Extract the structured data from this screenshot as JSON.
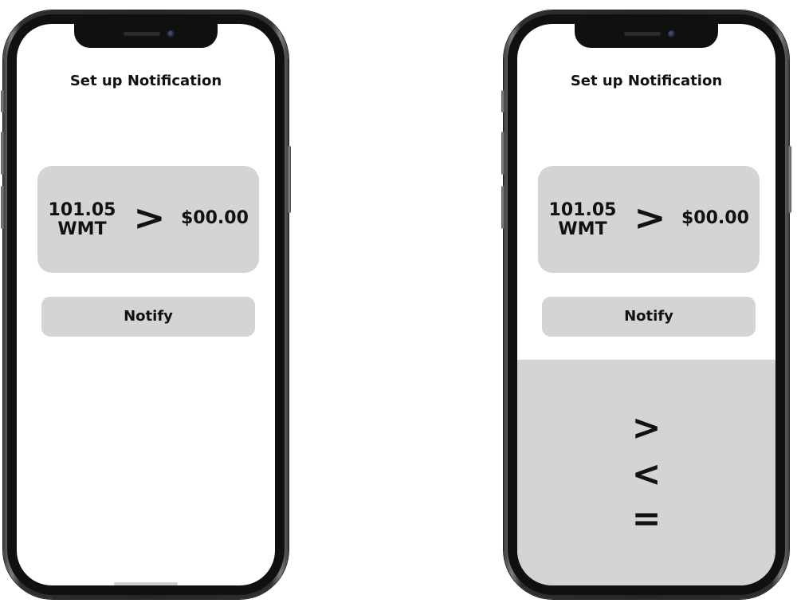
{
  "screens": [
    {
      "title": "Set up Notification",
      "stock_price": "101.05",
      "stock_symbol": "WMT",
      "comparator": ">",
      "target_price": "$00.00",
      "notify_label": "Notify"
    },
    {
      "title": "Set up Notification",
      "stock_price": "101.05",
      "stock_symbol": "WMT",
      "comparator": ">",
      "target_price": "$00.00",
      "notify_label": "Notify",
      "picker_options": [
        ">",
        "<",
        "="
      ]
    }
  ],
  "colors": {
    "card_background": "#d4d4d4",
    "text": "#111111",
    "screen_background": "#ffffff",
    "phone_frame": "#262626"
  }
}
